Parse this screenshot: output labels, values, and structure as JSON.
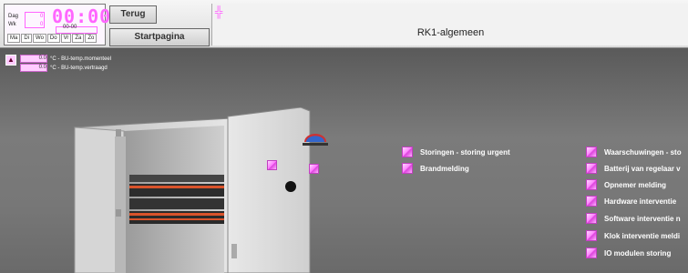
{
  "clock": {
    "time": "00:00",
    "day_label": "Dag",
    "week_label": "Wk",
    "day_value": "0",
    "week_value": "0",
    "date_value": "00-00",
    "days": [
      "Ma",
      "Di",
      "Wo",
      "Do",
      "Vr",
      "Za",
      "Zo"
    ]
  },
  "nav": {
    "back_label": "Terug",
    "home_label": "Startpagina"
  },
  "title_icon": "grid-icon",
  "page_title": "RK1-algemeen",
  "temps": [
    {
      "value": "0.0",
      "unit": "°C",
      "label": "- BU-temp.momenteel"
    },
    {
      "value": "0.0",
      "unit": "°C",
      "label": "- BU-temp.vertraagd"
    }
  ],
  "alarms_left": [
    "Storingen - storing urgent",
    "Brandmelding"
  ],
  "alarms_right": [
    "Waarschuwingen - sto",
    "Batterij van regelaar v",
    "Opnemer melding",
    "Hardware interventie",
    "Software interventie n",
    "Klok interventie meldi",
    "IO modulen storing"
  ],
  "colors": {
    "accent": "#ff66ff",
    "background": "#6b6b6b",
    "header": "#e8e8e8"
  }
}
